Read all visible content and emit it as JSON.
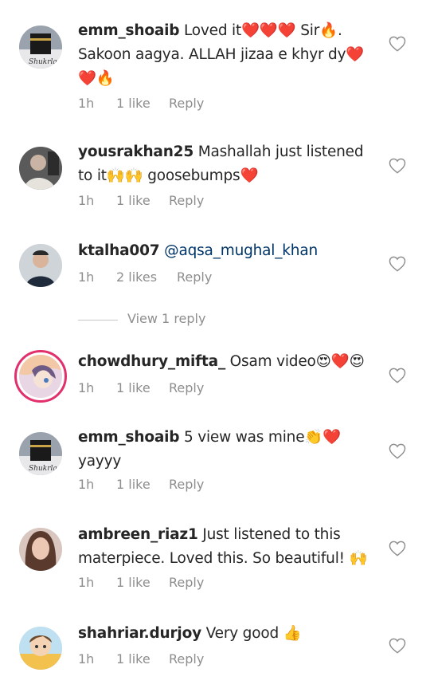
{
  "comments": [
    {
      "username": "emm_shoaib",
      "mention": "",
      "text": " Loved it❤️❤️❤️ Sir🔥. Sakoon aagya. ALLAH jizaa e khyr dy❤️❤️🔥",
      "time": "1h",
      "likes": "1 like",
      "reply": "Reply",
      "avatar_style": "kaaba"
    },
    {
      "username": "yousrakhan25",
      "mention": "",
      "text": " Mashallah just listened to it🙌🙌 goosebumps❤️",
      "time": "1h",
      "likes": "1 like",
      "reply": "Reply",
      "avatar_style": "dark"
    },
    {
      "username": "ktalha007",
      "mention": "@aqsa_mughal_khan",
      "text": "",
      "time": "1h",
      "likes": "2 likes",
      "reply": "Reply",
      "avatar_style": "person"
    },
    {
      "username": "chowdhury_mifta_",
      "mention": "",
      "text": " Osam video😍❤️😍",
      "time": "1h",
      "likes": "1 like",
      "reply": "Reply",
      "avatar_style": "anime"
    },
    {
      "username": "emm_shoaib",
      "mention": "",
      "text": " 5 view was mine👏❤️ yayyy",
      "time": "1h",
      "likes": "1 like",
      "reply": "Reply",
      "avatar_style": "kaaba"
    },
    {
      "username": "ambreen_riaz1",
      "mention": "",
      "text": " Just listened to this materpiece. Loved this. So beautiful! 🙌",
      "time": "1h",
      "likes": "1 like",
      "reply": "Reply",
      "avatar_style": "girl"
    },
    {
      "username": "shahriar.durjoy",
      "mention": "",
      "text": " Very good 👍",
      "time": "1h",
      "likes": "1 like",
      "reply": "Reply",
      "avatar_style": "cartoon"
    }
  ],
  "view_replies": "View 1 reply",
  "colors": {
    "meta": "#8e8e8e",
    "mention": "#003569",
    "story_ring": "#e1306c"
  }
}
